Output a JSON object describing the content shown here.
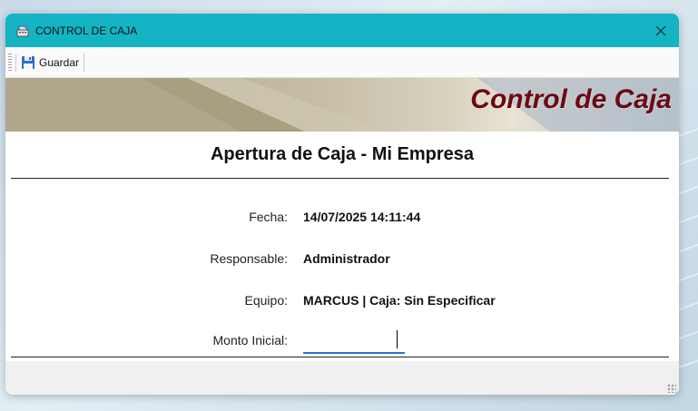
{
  "window": {
    "title": "CONTROL DE CAJA",
    "app_icon": "cash-register-icon",
    "close_icon": "close-icon"
  },
  "toolbar": {
    "save_label": "Guardar",
    "save_icon": "floppy-disk-icon"
  },
  "banner": {
    "title": "Control de Caja"
  },
  "form": {
    "heading": "Apertura de Caja - Mi Empresa",
    "fields": [
      {
        "label": "Fecha:",
        "value": "14/07/2025 14:11:44"
      },
      {
        "label": "Responsable:",
        "value": "Administrador"
      },
      {
        "label": "Equipo:",
        "value": "MARCUS | Caja: Sin Especificar"
      }
    ],
    "amount": {
      "label": "Monto Inicial:",
      "value": ""
    }
  },
  "colors": {
    "titlebar": "#14b4c4",
    "banner_text": "#6b0a12",
    "input_underline": "#2e6fd2"
  }
}
